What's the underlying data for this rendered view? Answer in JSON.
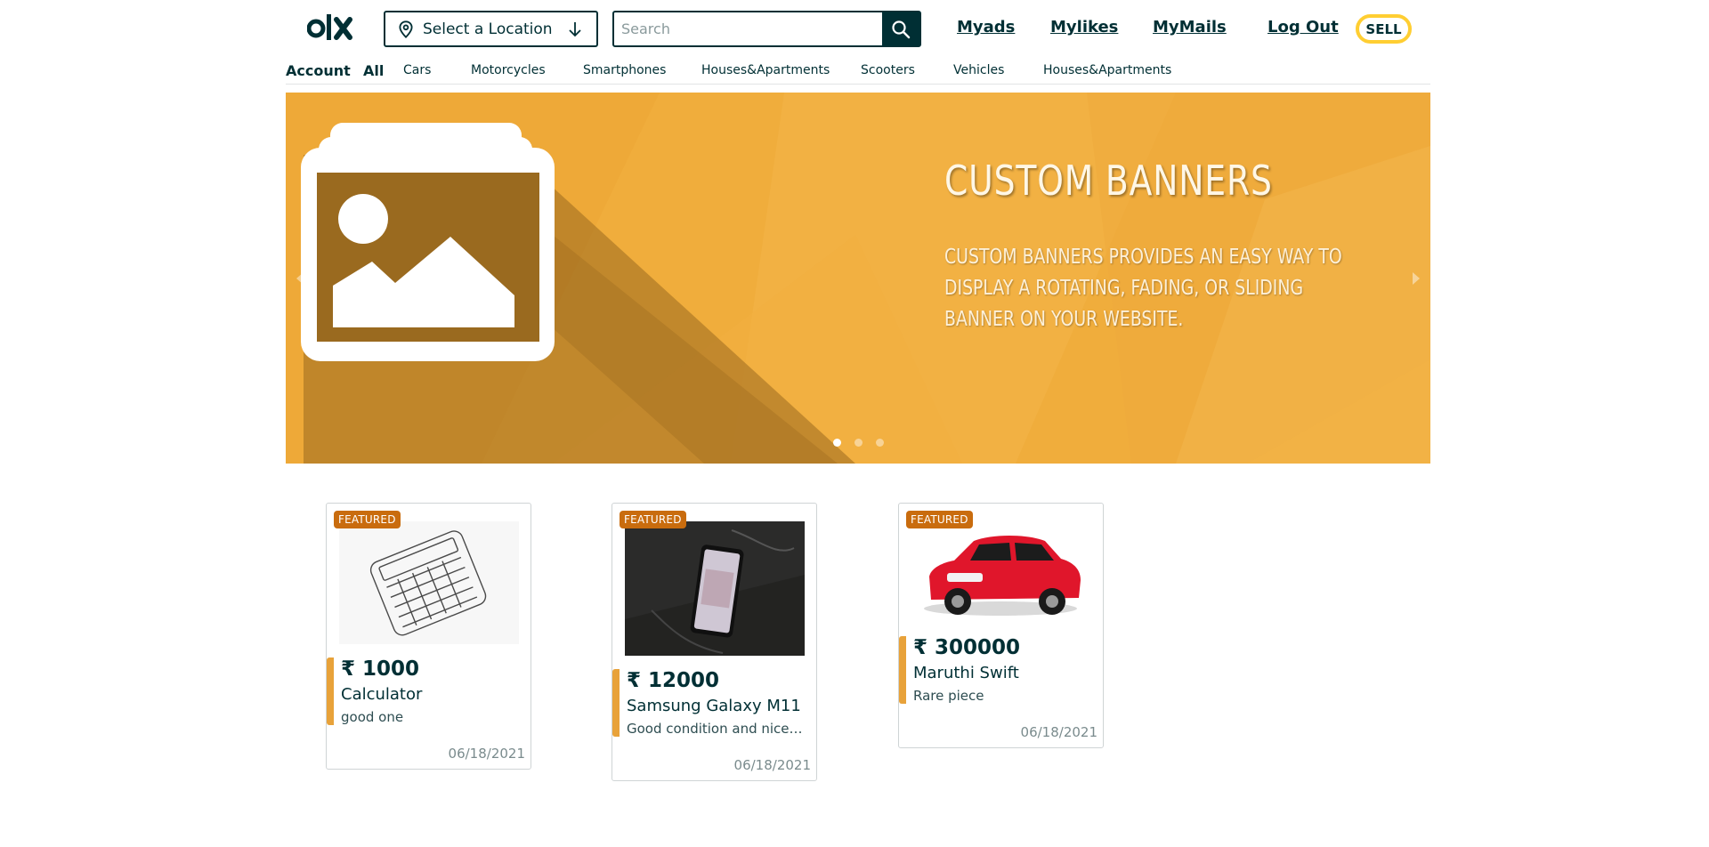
{
  "header": {
    "logo_text": "olx",
    "location_label": "Select a Location",
    "search_placeholder": "Search",
    "links": [
      "Myads",
      "Mylikes",
      "MyMails",
      "Log Out"
    ],
    "sell_label": "SELL"
  },
  "categories": {
    "account_label": "Account",
    "all_label": "All",
    "items": [
      "Cars",
      "Motorcycles",
      "Smartphones",
      "Houses&Apartments",
      "Scooters",
      "Vehicles",
      "Houses&Apartments"
    ]
  },
  "banner": {
    "title": "CUSTOM BANNERS",
    "text": "Custom Banners provides an easy way to display a rotating, fading, or sliding banner on your website.",
    "slides": 3,
    "active_slide": 1
  },
  "listings": [
    {
      "badge": "FEATURED",
      "price": "₹ 1000",
      "title": "Calculator",
      "description": "good one",
      "date": "06/18/2021",
      "image": "calculator"
    },
    {
      "badge": "FEATURED",
      "price": "₹ 12000",
      "title": "Samsung Galaxy M11",
      "description": "Good condition and nice phone",
      "date": "06/18/2021",
      "image": "smartphone"
    },
    {
      "badge": "FEATURED",
      "price": "₹ 300000",
      "title": "Maruthi Swift",
      "description": "Rare piece",
      "date": "06/18/2021",
      "image": "red-car"
    }
  ],
  "colors": {
    "brand_dark": "#002f34",
    "sell_border": "#ffce32",
    "banner_bg": "#f0ad3c",
    "featured_badge": "#c96c0e",
    "card_accent": "#e8a23a"
  }
}
